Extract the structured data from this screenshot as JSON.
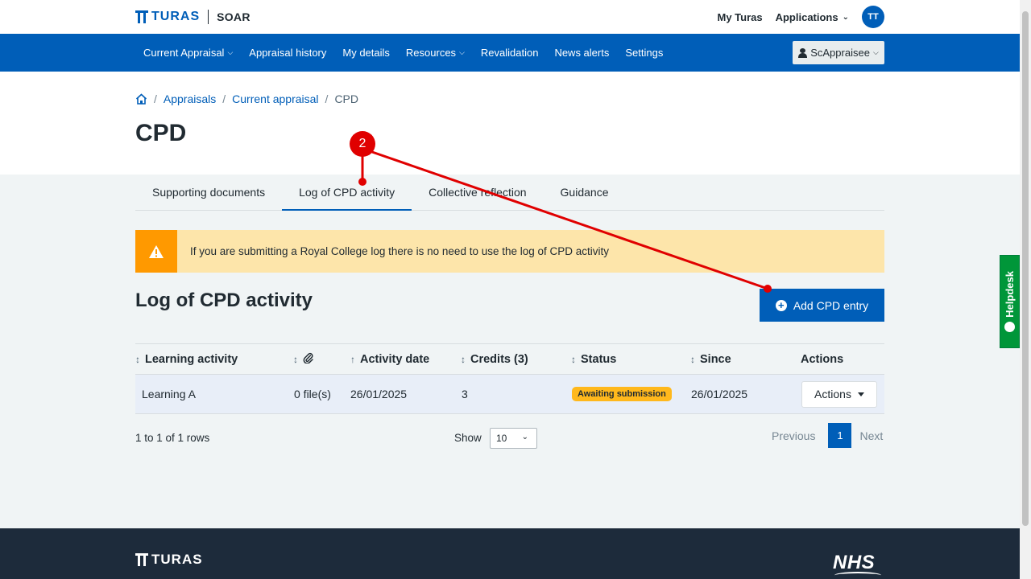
{
  "header": {
    "brand": "TURAS",
    "app_name": "SOAR",
    "my_turas": "My Turas",
    "applications": "Applications",
    "avatar_initials": "TT"
  },
  "nav": {
    "items": [
      {
        "label": "Current Appraisal",
        "dropdown": true
      },
      {
        "label": "Appraisal history",
        "dropdown": false
      },
      {
        "label": "My details",
        "dropdown": false
      },
      {
        "label": "Resources",
        "dropdown": true
      },
      {
        "label": "Revalidation",
        "dropdown": false
      },
      {
        "label": "News alerts",
        "dropdown": false
      },
      {
        "label": "Settings",
        "dropdown": false
      }
    ],
    "user_label": "ScAppraisee"
  },
  "breadcrumb": {
    "items": [
      "Appraisals",
      "Current appraisal"
    ],
    "current": "CPD"
  },
  "page_title": "CPD",
  "tabs": [
    {
      "label": "Supporting documents",
      "active": false
    },
    {
      "label": "Log of CPD activity",
      "active": true
    },
    {
      "label": "Collective reflection",
      "active": false
    },
    {
      "label": "Guidance",
      "active": false
    }
  ],
  "warning": {
    "text": "If you are submitting a Royal College log there is no need to use the log of CPD activity"
  },
  "section": {
    "title": "Log of CPD activity",
    "add_button": "Add CPD entry"
  },
  "table": {
    "columns": [
      "Learning activity",
      "",
      "Activity date",
      "Credits (3)",
      "Status",
      "Since",
      "Actions"
    ],
    "rows": [
      {
        "activity": "Learning A",
        "files": "0 file(s)",
        "date": "26/01/2025",
        "credits": "3",
        "status": "Awaiting submission",
        "since": "26/01/2025",
        "actions": "Actions"
      }
    ]
  },
  "pagination": {
    "rows_info": "1 to 1 of 1 rows",
    "show_label": "Show",
    "page_size": "10",
    "previous": "Previous",
    "current_page": "1",
    "next": "Next"
  },
  "footer": {
    "brand": "TURAS",
    "nhs": "NHS"
  },
  "helpdesk": "Helpdesk",
  "annotation": {
    "step_number": "2"
  },
  "colors": {
    "primary": "#005eb8",
    "warning_bg": "#fde5aa",
    "warning_accent": "#ff9900",
    "badge": "#ffb81c",
    "footer": "#1d2b3b",
    "helpdesk": "#009639",
    "annotation": "#e00000"
  }
}
